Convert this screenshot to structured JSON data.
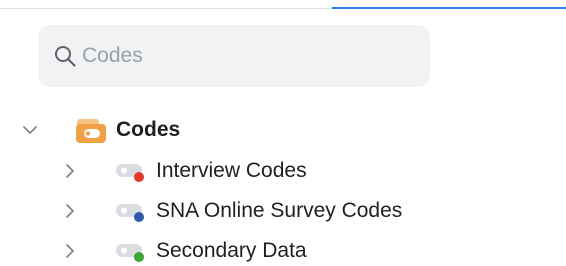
{
  "search": {
    "placeholder": "Codes"
  },
  "tree": {
    "root": {
      "label": "Codes",
      "icon": "folder-codes-icon",
      "expanded": true,
      "icon_color": "#f0a146"
    },
    "children": [
      {
        "label": "Interview Codes",
        "icon": "code-tag-icon",
        "dot_color": "#e03a2c",
        "expanded": false
      },
      {
        "label": "SNA Online Survey Codes",
        "icon": "code-tag-icon",
        "dot_color": "#2a5aa8",
        "expanded": false
      },
      {
        "label": "Secondary Data",
        "icon": "code-tag-icon",
        "dot_color": "#3fa535",
        "expanded": false
      }
    ]
  },
  "colors": {
    "accent": "#2b7de9",
    "search_bg": "#f1f2f4"
  }
}
